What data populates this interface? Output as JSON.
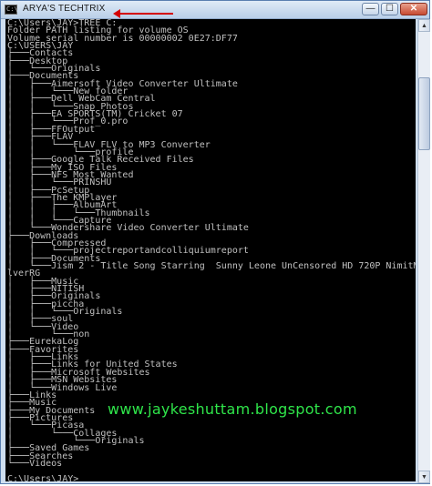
{
  "window": {
    "title": "ARYA'S TECHTRIX",
    "icon_text": "C:\\",
    "minimize_icon": "minimize-icon",
    "maximize_icon": "maximize-icon",
    "close_icon": "close-icon",
    "minimize_glyph": "—",
    "maximize_glyph": "☐",
    "close_glyph": "✕"
  },
  "console": {
    "text_color": "#c0c0c0",
    "background": "#000000",
    "lines": [
      "C:\\Users\\JAY>TREE C:",
      "Folder PATH listing for volume OS",
      "Volume serial number is 00000002 0E27:DF77",
      "C:\\USERS\\JAY",
      "├───Contacts",
      "├───Desktop",
      "│   └───Originals",
      "├───Documents",
      "│   ├───Aimersoft Video Converter Ultimate",
      "│   │   └───New folder",
      "│   ├───Dell WebCam Central",
      "│   │   └───Snap Photos",
      "│   ├───EA SPORTS(TM) Cricket 07",
      "│   │   └───Prof_0.pro",
      "│   ├───FFOutput",
      "│   ├───FLAV",
      "│   │   └───FLAV FLV to MP3 Converter",
      "│   │       └───profile",
      "│   ├───Google Talk Received Files",
      "│   ├───My ISO Files",
      "│   ├───NFS Most Wanted",
      "│   │   └───PRINSHU",
      "│   ├───PcSetup",
      "│   ├───The KMPlayer",
      "│   │   ├───AlbumArt",
      "│   │   │   └───Thumbnails",
      "│   │   └───Capture",
      "│   └───Wondershare Video Converter Ultimate",
      "├───Downloads",
      "│   ├───Compressed",
      "│   │   └───projectreportandcolliquiumreport",
      "│   ├───Documents",
      "│   └───Jism 2 - Title Song Starring  Sunny Leone UnCensored HD 720P NimitMak Sil",
      "lverRG",
      "│   ├───Music",
      "│   ├───NITISH",
      "│   ├───Originals",
      "│   ├───piccha",
      "│   │   └───Originals",
      "│   ├───soul",
      "│   └───Video",
      "│       └───non",
      "├───EurekaLog",
      "├───Favorites",
      "│   ├───Links",
      "│   ├───Links for United States",
      "│   ├───Microsoft Websites",
      "│   ├───MSN Websites",
      "│   └───Windows Live",
      "├───Links",
      "├───Music",
      "├───My Documents",
      "├───Pictures",
      "│   └───Picasa",
      "│       └───Collages",
      "│           └───Originals",
      "├───Saved Games",
      "├───Searches",
      "└───Videos",
      "",
      "C:\\Users\\JAY>"
    ]
  },
  "watermark": {
    "text": "www.jaykeshuttam.blogspot.com",
    "color": "#2fe54a"
  },
  "scrollbar": {
    "up_glyph": "▲",
    "down_glyph": "▼"
  }
}
